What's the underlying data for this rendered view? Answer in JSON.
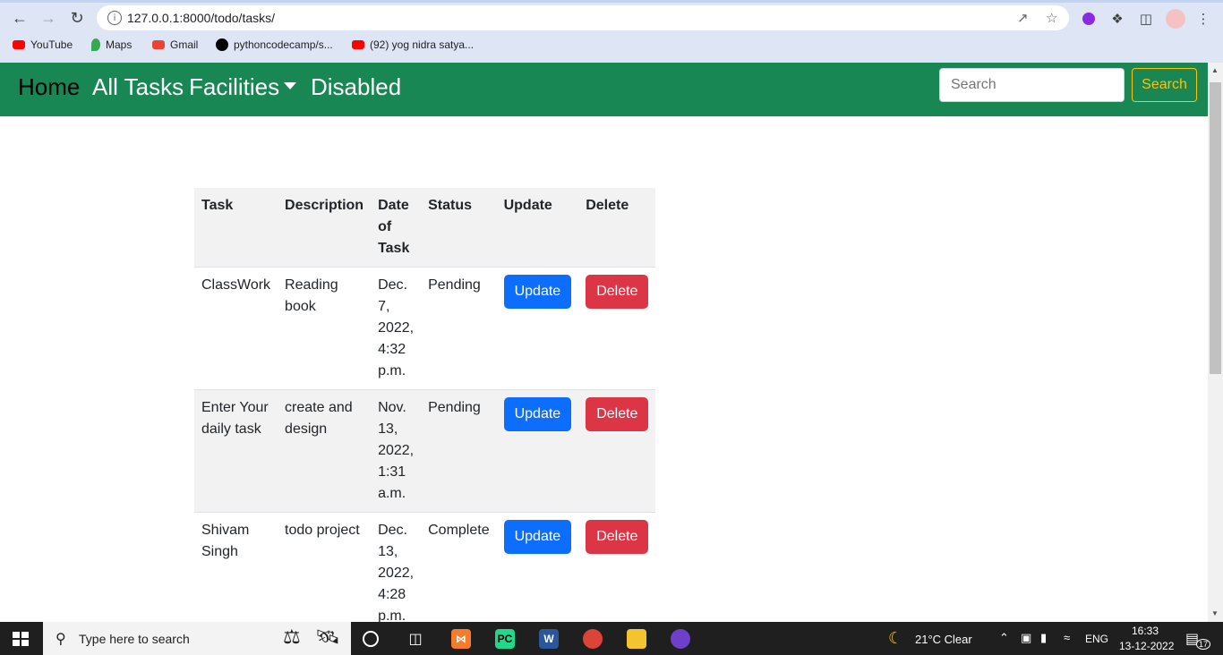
{
  "browser": {
    "url": "127.0.0.1:8000/todo/tasks/",
    "bookmarks": [
      {
        "label": "YouTube",
        "icon": "youtube-icon",
        "color": "#ff0000"
      },
      {
        "label": "Maps",
        "icon": "maps-icon",
        "color": "#34a853"
      },
      {
        "label": "Gmail",
        "icon": "gmail-icon",
        "color": "#ea4335"
      },
      {
        "label": "pythoncodecamp/s...",
        "icon": "github-icon",
        "color": "#000000"
      },
      {
        "label": "(92) yog nidra satya...",
        "icon": "youtube-icon",
        "color": "#ff0000"
      }
    ]
  },
  "navbar": {
    "brand": "Home",
    "links": [
      "All Tasks",
      "Facilities",
      "Disabled"
    ],
    "search_placeholder": "Search",
    "search_button": "Search",
    "bg_color": "#198754"
  },
  "table": {
    "headers": [
      "Task",
      "Description",
      "Date of Task",
      "Status",
      "Update",
      "Delete"
    ],
    "rows": [
      {
        "task": "ClassWork",
        "description": "Reading book",
        "date": "Dec. 7, 2022, 4:32 p.m.",
        "status": "Pending",
        "update": "Update",
        "delete": "Delete"
      },
      {
        "task": "Enter Your daily task",
        "description": "create and design",
        "date": "Nov. 13, 2022, 1:31 a.m.",
        "status": "Pending",
        "update": "Update",
        "delete": "Delete"
      },
      {
        "task": "Shivam Singh",
        "description": "todo project",
        "date": "Dec. 13, 2022, 4:28 p.m.",
        "status": "Complete",
        "update": "Update",
        "delete": "Delete"
      }
    ]
  },
  "taskbar": {
    "search_placeholder": "Type here to search",
    "weather": "21°C  Clear",
    "language": "ENG",
    "time": "16:33",
    "date": "13-12-2022",
    "notifications": "17"
  }
}
